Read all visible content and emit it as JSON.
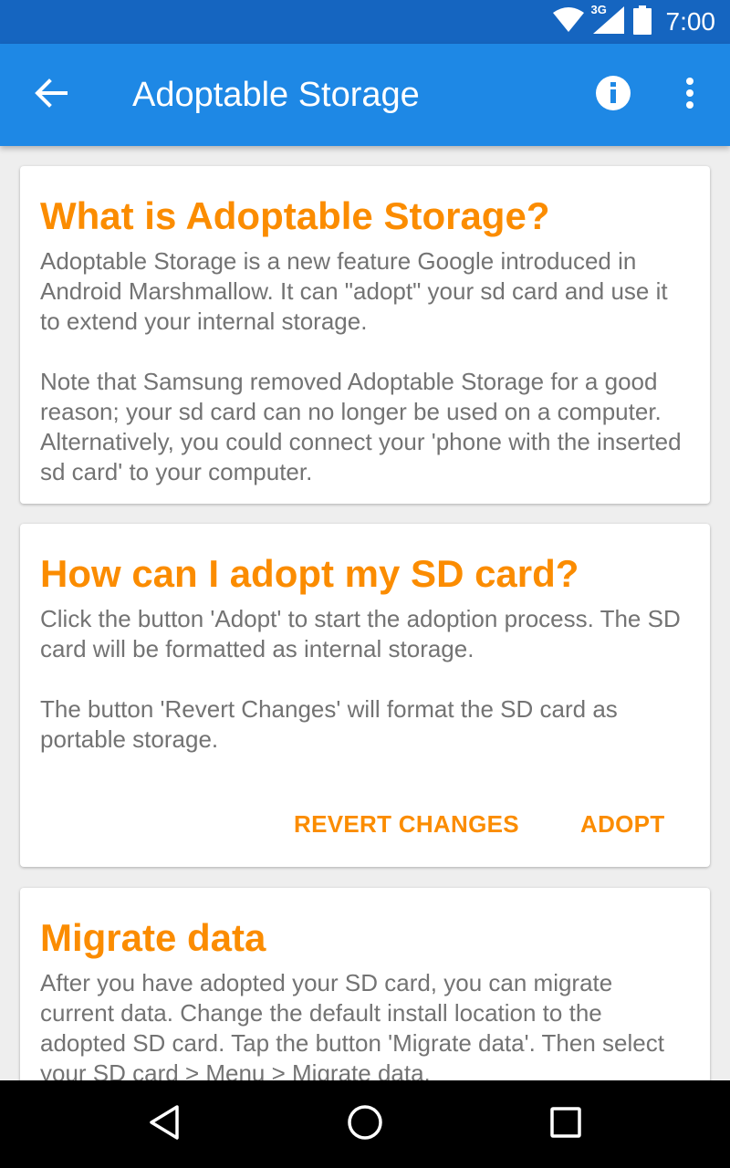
{
  "status_bar": {
    "network": "3G",
    "time": "7:00",
    "icons": [
      "wifi-icon",
      "cell-signal-icon",
      "battery-icon"
    ]
  },
  "app_bar": {
    "title": "Adoptable Storage",
    "back_icon": "arrow-back-icon",
    "info_icon": "info-icon",
    "more_icon": "more-vert-icon",
    "color": "#1e88e5"
  },
  "cards": [
    {
      "title": "What is Adoptable Storage?",
      "paragraphs": [
        "Adoptable Storage is a new feature Google introduced in Android Marshmallow. It can \"adopt\" your sd card and use it to extend your internal storage.",
        "Note that Samsung removed Adoptable Storage for a good reason; your sd card can no longer be used on a computer. Alternatively, you could connect your 'phone with the inserted sd card' to your computer."
      ]
    },
    {
      "title": "How can I adopt my SD card?",
      "paragraphs": [
        "Click the button 'Adopt' to start the adoption process. The SD card will be formatted as internal storage.",
        "The button 'Revert Changes' will format the SD card as portable storage."
      ],
      "actions": {
        "revert_label": "REVERT CHANGES",
        "adopt_label": "ADOPT"
      }
    },
    {
      "title": "Migrate data",
      "paragraphs": [
        "After you have adopted your SD card, you can migrate current data. Change the default install location to the adopted SD card. Tap the button 'Migrate data'. Then select your SD card > Menu > Migrate data."
      ]
    }
  ],
  "nav_bar": {
    "icons": [
      "back-triangle-icon",
      "home-circle-icon",
      "recents-square-icon"
    ]
  },
  "accent_color": "#fb8c00"
}
